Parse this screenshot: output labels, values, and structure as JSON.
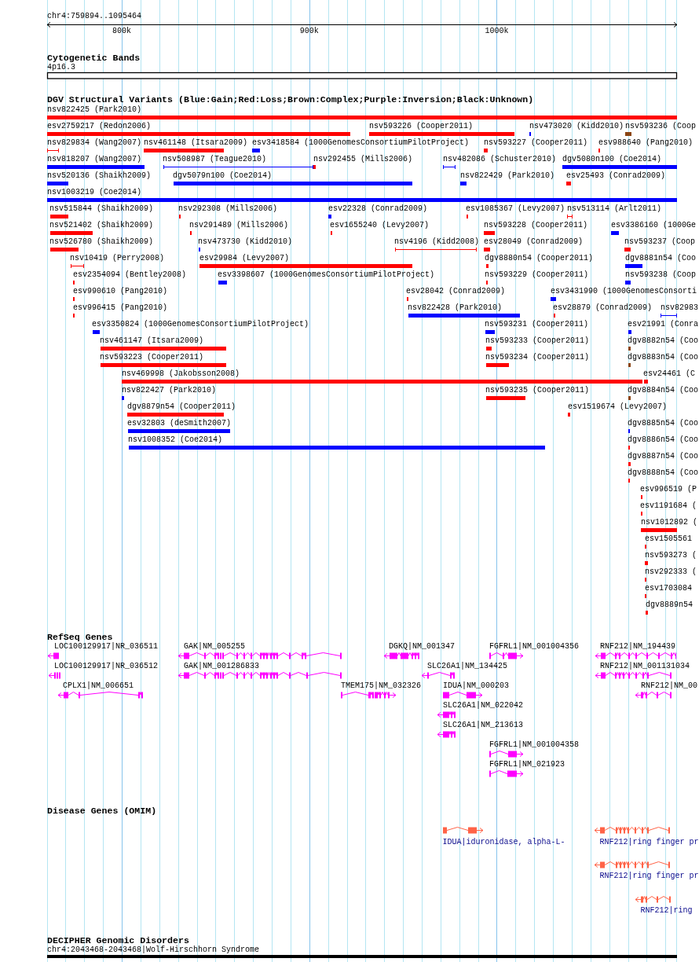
{
  "ruler": {
    "location": "chr4:759894..1095464",
    "ticks": [
      "800k",
      "900k",
      "1000k"
    ]
  },
  "tracks": [
    {
      "kind": "bands",
      "title": "Cytogenetic Bands",
      "items": [
        {
          "label": "4p16.3"
        }
      ]
    },
    {
      "kind": "variants",
      "title": "DGV Structural Variants (Blue:Gain;Red:Loss;Brown:Complex;Purple:Inversion;Black:Unknown)",
      "items": [
        {
          "label": "nsv822425 (Park2010)",
          "color": "#ff0000",
          "kind": "bar"
        },
        {
          "label": "esv2759217 (Redon2006)",
          "color": "#ff0000",
          "kind": "bar"
        },
        {
          "label": "nsv593226 (Cooper2011)",
          "color": "#ff0000",
          "kind": "bar"
        },
        {
          "label": "nsv473020 (Kidd2010)",
          "color": "#0000ff",
          "kind": "bar"
        },
        {
          "label": "nsv593236 (Coop",
          "color": "#8b4513",
          "kind": "bar"
        },
        {
          "label": "nsv829834 (Wang2007)",
          "color": "#ff0000",
          "kind": "span"
        },
        {
          "label": "nsv461148 (Itsara2009)",
          "color": "#ff0000",
          "kind": "bar"
        },
        {
          "label": "esv3418584 (1000GenomesConsortiumPilotProject)",
          "color": "#0000ff",
          "kind": "bar"
        },
        {
          "label": "nsv593227 (Cooper2011)",
          "color": "#ff0000",
          "kind": "bar"
        },
        {
          "label": "esv988640 (Pang2010)",
          "color": "#ff0000",
          "kind": "bar"
        },
        {
          "label": "nsv818207 (Wang2007)",
          "color": "#0000ff",
          "kind": "bar"
        },
        {
          "label": "nsv508987 (Teague2010)",
          "color": "#0000ff",
          "kind": "span"
        },
        {
          "label": "nsv292455 (Mills2006)",
          "color": "#ff0000",
          "kind": "bar"
        },
        {
          "label": "nsv482086 (Schuster2010)",
          "color": "#0000ff",
          "kind": "span"
        },
        {
          "label": "dgv5080n100 (Coe2014)",
          "color": "#0000ff",
          "kind": "bar"
        },
        {
          "label": "nsv520136 (Shaikh2009)",
          "color": "#0000ff",
          "kind": "bar"
        },
        {
          "label": "dgv5079n100 (Coe2014)",
          "color": "#0000ff",
          "kind": "bar"
        },
        {
          "label": "nsv822429 (Park2010)",
          "color": "#0000ff",
          "kind": "bar"
        },
        {
          "label": "esv25493 (Conrad2009)",
          "color": "#ff0000",
          "kind": "bar"
        },
        {
          "label": "nsv1003219 (Coe2014)",
          "color": "#0000ff",
          "kind": "bar"
        },
        {
          "label": "nsv515844 (Shaikh2009)",
          "color": "#ff0000",
          "kind": "bar"
        },
        {
          "label": "nsv292308 (Mills2006)",
          "color": "#ff0000",
          "kind": "bar"
        },
        {
          "label": "esv22328 (Conrad2009)",
          "color": "#0000ff",
          "kind": "bar"
        },
        {
          "label": "esv1085367 (Levy2007)",
          "color": "#ff0000",
          "kind": "bar"
        },
        {
          "label": "nsv513114 (Arlt2011)",
          "color": "#ff0000",
          "kind": "span"
        },
        {
          "label": "nsv521402 (Shaikh2009)",
          "color": "#ff0000",
          "kind": "bar"
        },
        {
          "label": "nsv291489 (Mills2006)",
          "color": "#ff0000",
          "kind": "bar"
        },
        {
          "label": "esv1655240 (Levy2007)",
          "color": "#ff0000",
          "kind": "bar"
        },
        {
          "label": "nsv593228 (Cooper2011)",
          "color": "#ff0000",
          "kind": "bar"
        },
        {
          "label": "esv3386160 (1000Ge",
          "color": "#0000ff",
          "kind": "bar"
        },
        {
          "label": "nsv526780 (Shaikh2009)",
          "color": "#ff0000",
          "kind": "bar"
        },
        {
          "label": "nsv473730 (Kidd2010)",
          "color": "#0000ff",
          "kind": "bar"
        },
        {
          "label": "nsv4196 (Kidd2008)",
          "color": "#ff0000",
          "kind": "span"
        },
        {
          "label": "esv28049 (Conrad2009)",
          "color": "#ff0000",
          "kind": "bar"
        },
        {
          "label": "nsv593237 (Coop",
          "color": "#ff0000",
          "kind": "bar"
        },
        {
          "label": "nsv10419 (Perry2008)",
          "color": "#ff0000",
          "kind": "span"
        },
        {
          "label": "esv29984 (Levy2007)",
          "color": "#ff0000",
          "kind": "bar"
        },
        {
          "label": "dgv8880n54 (Cooper2011)",
          "color": "#ff0000",
          "kind": "bar"
        },
        {
          "label": "dgv8881n54 (Coo",
          "color": "#0000ff",
          "kind": "bar"
        },
        {
          "label": "esv2354094 (Bentley2008)",
          "color": "#ff0000",
          "kind": "bar"
        },
        {
          "label": "esv3398607 (1000GenomesConsortiumPilotProject)",
          "color": "#0000ff",
          "kind": "bar"
        },
        {
          "label": "nsv593229 (Cooper2011)",
          "color": "#ff0000",
          "kind": "bar"
        },
        {
          "label": "nsv593238 (Coop",
          "color": "#0000ff",
          "kind": "bar"
        },
        {
          "label": "esv990610 (Pang2010)",
          "color": "#ff0000",
          "kind": "bar"
        },
        {
          "label": "esv28042 (Conrad2009)",
          "color": "#ff0000",
          "kind": "bar"
        },
        {
          "label": "esv3431990 (1000GenomesConsorti",
          "color": "#0000ff",
          "kind": "bar"
        },
        {
          "label": "esv996415 (Pang2010)",
          "color": "#ff0000",
          "kind": "bar"
        },
        {
          "label": "nsv822428 (Park2010)",
          "color": "#0000ff",
          "kind": "bar"
        },
        {
          "label": "esv28879 (Conrad2009)",
          "color": "#ff0000",
          "kind": "bar"
        },
        {
          "label": "nsv82983",
          "color": "#0000ff",
          "kind": "span"
        },
        {
          "label": "esv3350824 (1000GenomesConsortiumPilotProject)",
          "color": "#0000ff",
          "kind": "bar"
        },
        {
          "label": "nsv593231 (Cooper2011)",
          "color": "#0000ff",
          "kind": "bar"
        },
        {
          "label": "esv21991 (Conra",
          "color": "#0000ff",
          "kind": "bar"
        },
        {
          "label": "nsv461147 (Itsara2009)",
          "color": "#ff0000",
          "kind": "bar"
        },
        {
          "label": "nsv593233 (Cooper2011)",
          "color": "#ff0000",
          "kind": "bar"
        },
        {
          "label": "dgv8882n54 (Coo",
          "color": "#8b4513",
          "kind": "bar"
        },
        {
          "label": "nsv593223 (Cooper2011)",
          "color": "#ff0000",
          "kind": "bar"
        },
        {
          "label": "nsv593234 (Cooper2011)",
          "color": "#ff0000",
          "kind": "bar"
        },
        {
          "label": "dgv8883n54 (Coo",
          "color": "#8b4513",
          "kind": "bar"
        },
        {
          "label": "nsv469998 (Jakobsson2008)",
          "color": "#ff0000",
          "kind": "bar"
        },
        {
          "label": "esv24461 (C",
          "color": "#ff0000",
          "kind": "bar"
        },
        {
          "label": "nsv822427 (Park2010)",
          "color": "#0000ff",
          "kind": "bar"
        },
        {
          "label": "nsv593235 (Cooper2011)",
          "color": "#ff0000",
          "kind": "bar"
        },
        {
          "label": "dgv8884n54 (Coo",
          "color": "#8b4513",
          "kind": "bar"
        },
        {
          "label": "dgv8879n54 (Cooper2011)",
          "color": "#ff0000",
          "kind": "bar"
        },
        {
          "label": "esv1519674 (Levy2007)",
          "color": "#ff0000",
          "kind": "bar"
        },
        {
          "label": "esv32803 (deSmith2007)",
          "color": "#0000ff",
          "kind": "bar"
        },
        {
          "label": "dgv8885n54 (Coo",
          "color": "#0000ff",
          "kind": "bar"
        },
        {
          "label": "nsv1008352 (Coe2014)",
          "color": "#0000ff",
          "kind": "bar"
        },
        {
          "label": "dgv8886n54 (Coo",
          "color": "#ff0000",
          "kind": "bar"
        },
        {
          "label": "dgv8887n54 (Coo",
          "color": "#ff0000",
          "kind": "bar"
        },
        {
          "label": "dgv8888n54 (Coo",
          "color": "#ff0000",
          "kind": "bar"
        },
        {
          "label": "esv996519 (P",
          "color": "#ff0000",
          "kind": "bar"
        },
        {
          "label": "esv1191684 (",
          "color": "#ff0000",
          "kind": "bar"
        },
        {
          "label": "nsv1012892 (",
          "color": "#ff0000",
          "kind": "bar"
        },
        {
          "label": "esv1505561",
          "color": "#ff0000",
          "kind": "bar"
        },
        {
          "label": "nsv593273 (",
          "color": "#ff0000",
          "kind": "bar"
        },
        {
          "label": "nsv292333 (",
          "color": "#ff0000",
          "kind": "bar"
        },
        {
          "label": "esv1703084",
          "color": "#ff0000",
          "kind": "bar"
        },
        {
          "label": "dgv8889n54",
          "color": "#ff0000",
          "kind": "bar"
        }
      ]
    },
    {
      "kind": "genes",
      "title": "RefSeq Genes",
      "items": [
        {
          "label": "LOC100129917|NR_036511",
          "reverse_strand": true
        },
        {
          "label": "GAK|NM_005255",
          "reverse_strand": true
        },
        {
          "label": "DGKQ|NM_001347",
          "reverse_strand": true
        },
        {
          "label": "FGFRL1|NM_001004356",
          "reverse_strand": false
        },
        {
          "label": "RNF212|NM_194439",
          "reverse_strand": true
        },
        {
          "label": "LOC100129917|NR_036512",
          "reverse_strand": true
        },
        {
          "label": "GAK|NM_001286833",
          "reverse_strand": true
        },
        {
          "label": "SLC26A1|NM_134425",
          "reverse_strand": true
        },
        {
          "label": "RNF212|NM_001131034",
          "reverse_strand": true
        },
        {
          "label": "CPLX1|NM_006651",
          "reverse_strand": true
        },
        {
          "label": "TMEM175|NM_032326",
          "reverse_strand": false
        },
        {
          "label": "IDUA|NM_000203",
          "reverse_strand": false
        },
        {
          "label": "RNF212|NM_00",
          "reverse_strand": true
        },
        {
          "label": "SLC26A1|NM_022042",
          "reverse_strand": true
        },
        {
          "label": "SLC26A1|NM_213613",
          "reverse_strand": true
        },
        {
          "label": "FGFRL1|NM_001004358",
          "reverse_strand": false
        },
        {
          "label": "FGFRL1|NM_021923",
          "reverse_strand": false
        }
      ]
    },
    {
      "kind": "disease_genes",
      "title": "Disease Genes (OMIM)",
      "items": [
        {
          "label": "IDUA|iduronidase, alpha-L-",
          "reverse_strand": false
        },
        {
          "label": "RNF212|ring finger pr",
          "reverse_strand": true
        },
        {
          "label": "RNF212|ring finger pr",
          "reverse_strand": true
        },
        {
          "label": "RNF212|ring",
          "reverse_strand": true
        }
      ]
    },
    {
      "kind": "disorders",
      "title": "DECIPHER Genomic Disorders",
      "items": [
        {
          "label": "chr4:2043468-2043468|Wolf-Hirschhorn Syndrome"
        }
      ]
    }
  ]
}
